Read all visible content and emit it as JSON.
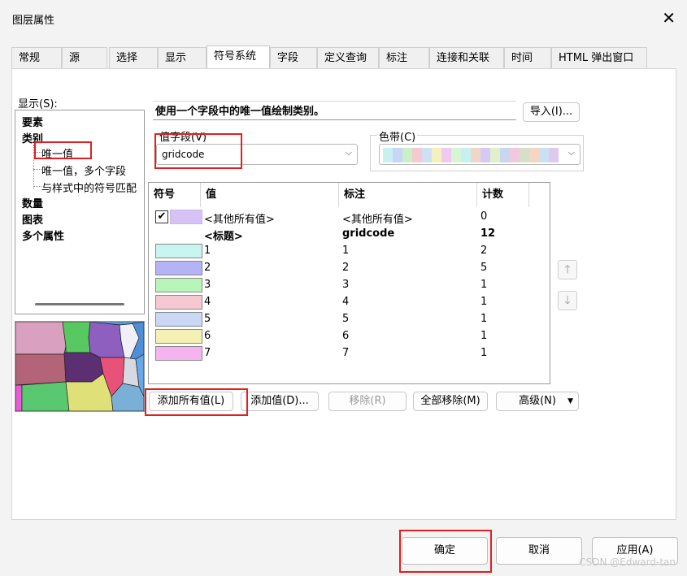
{
  "window": {
    "title": "图层属性"
  },
  "tabs": [
    "常规",
    "源",
    "选择",
    "显示",
    "符号系统",
    "字段",
    "定义查询",
    "标注",
    "连接和关联",
    "时间",
    "HTML 弹出窗口"
  ],
  "active_tab": "符号系统",
  "show": {
    "label": "显示(S):",
    "items": [
      {
        "label": "要素",
        "bold": true
      },
      {
        "label": "类别",
        "bold": true
      },
      {
        "label": "唯一值",
        "bold": false
      },
      {
        "label": "唯一值，多个字段",
        "bold": false
      },
      {
        "label": "与样式中的符号匹配",
        "bold": false
      },
      {
        "label": "数量",
        "bold": true
      },
      {
        "label": "图表",
        "bold": true
      },
      {
        "label": "多个属性",
        "bold": true
      }
    ]
  },
  "description": "使用一个字段中的唯一值绘制类别。",
  "import_button": "导入(I)...",
  "value_field": {
    "label": "值字段(V)",
    "value": "gridcode"
  },
  "color_ramp": {
    "label": "色带(C)",
    "colors": [
      "#c9f0f0",
      "#c8d6f5",
      "#c9f0c9",
      "#f5c9cf",
      "#cfe0f5",
      "#f5f0c0",
      "#f0c9f0",
      "#d6f5d6",
      "#c9f0f0",
      "#f0d6c9",
      "#d6c9f5",
      "#e0f0c9",
      "#c9d6f0",
      "#f0c9e0",
      "#d6e0c9",
      "#f5d6c0",
      "#c9e0f5",
      "#e0c9f0"
    ]
  },
  "table": {
    "headers": [
      "符号",
      "值",
      "标注",
      "计数"
    ],
    "rows": [
      {
        "color": "#d6c2f5",
        "value": "<其他所有值>",
        "label": "<其他所有值>",
        "count": "0",
        "checked": true,
        "bold": false
      },
      {
        "color": "",
        "value": "<标题>",
        "label": "gridcode",
        "count": "12",
        "checked": false,
        "bold": true
      },
      {
        "color": "#c8f5f0",
        "value": "1",
        "label": "1",
        "count": "2",
        "checked": false,
        "bold": false
      },
      {
        "color": "#b3b3f5",
        "value": "2",
        "label": "2",
        "count": "5",
        "checked": false,
        "bold": false
      },
      {
        "color": "#b8f5b8",
        "value": "3",
        "label": "3",
        "count": "1",
        "checked": false,
        "bold": false
      },
      {
        "color": "#f5c8d2",
        "value": "4",
        "label": "4",
        "count": "1",
        "checked": false,
        "bold": false
      },
      {
        "color": "#c8d8f5",
        "value": "5",
        "label": "5",
        "count": "1",
        "checked": false,
        "bold": false
      },
      {
        "color": "#f5f0b3",
        "value": "6",
        "label": "6",
        "count": "1",
        "checked": false,
        "bold": false
      },
      {
        "color": "#f5b3f0",
        "value": "7",
        "label": "7",
        "count": "1",
        "checked": false,
        "bold": false
      }
    ]
  },
  "action_buttons": {
    "add_all": "添加所有值(L)",
    "add": "添加值(D)...",
    "remove": "移除(R)",
    "remove_all": "全部移除(M)",
    "advanced": "高级(N)"
  },
  "bottom_buttons": {
    "ok": "确定",
    "cancel": "取消",
    "apply": "应用(A)"
  },
  "watermark": "CSDN @Edward-tan"
}
